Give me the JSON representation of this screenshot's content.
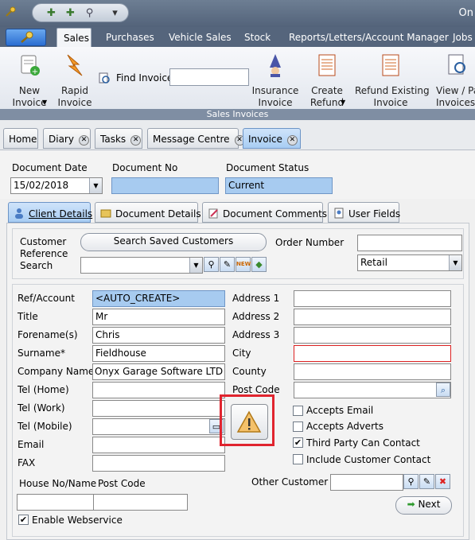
{
  "app": {
    "title_fragment": "On"
  },
  "quick_access": {
    "icons": [
      "add-doc-icon",
      "add-doc-icon",
      "search-doc-icon",
      "dropdown-arrow-icon"
    ]
  },
  "ribbon_tabs": [
    "Sales",
    "Purchases",
    "Vehicle Sales",
    "Stock",
    "Reports/Letters/Account Manager",
    "Jobs"
  ],
  "ribbon": {
    "new_invoice": "New\nInvoice",
    "rapid_invoice": "Rapid\nInvoice",
    "find_invoice": "Find Invoice",
    "find_invoice_value": "",
    "insurance_invoice": "Insurance\nInvoice",
    "create_refund": "Create\nRefund",
    "refund_existing": "Refund Existing\nInvoice",
    "view_pa": "View / Pa\nInvoices",
    "group_label": "Sales Invoices"
  },
  "doc_tabs": [
    {
      "label": "Home",
      "closable": false
    },
    {
      "label": "Diary",
      "closable": true
    },
    {
      "label": "Tasks",
      "closable": true
    },
    {
      "label": "Message Centre",
      "closable": true
    },
    {
      "label": "Invoice",
      "closable": true,
      "active": true
    }
  ],
  "header": {
    "document_date_label": "Document Date",
    "document_date": "15/02/2018",
    "document_no_label": "Document No",
    "document_no": "",
    "document_status_label": "Document Status",
    "document_status": "Current"
  },
  "section_tabs": [
    "Client Details",
    "Document Details",
    "Document Comments",
    "User Fields"
  ],
  "search": {
    "customer_ref_label_1": "Customer",
    "customer_ref_label_2": "Reference",
    "customer_ref_label_3": "Search",
    "saved_customers_button": "Search Saved Customers",
    "order_number_label": "Order Number",
    "order_number": "",
    "price_type": "Retail"
  },
  "client": {
    "ref_label": "Ref/Account",
    "ref": "<AUTO_CREATE>",
    "title_label": "Title",
    "title": "Mr",
    "forename_label": "Forename(s)",
    "forename": "Chris",
    "surname_label": "Surname*",
    "surname": "Fieldhouse",
    "company_label": "Company Name",
    "company": "Onyx Garage Software LTD",
    "tel_home_label": "Tel (Home)",
    "tel_home": "",
    "tel_work_label": "Tel (Work)",
    "tel_work": "",
    "tel_mobile_label": "Tel (Mobile)",
    "tel_mobile": "",
    "email_label": "Email",
    "email": "",
    "fax_label": "FAX",
    "fax": "",
    "house_label": "House No/Name",
    "house": "",
    "postcode_label2": "Post Code",
    "postcode2": "",
    "address1_label": "Address 1",
    "address1": "",
    "address2_label": "Address 2",
    "address2": "",
    "address3_label": "Address 3",
    "address3": "",
    "city_label": "City",
    "city": "",
    "county_label": "County",
    "county": "",
    "postcode_label": "Post Code",
    "postcode": ""
  },
  "options": {
    "accepts_email": {
      "label": "Accepts Email",
      "checked": false
    },
    "accepts_adverts": {
      "label": "Accepts Adverts",
      "checked": false
    },
    "third_party": {
      "label": "Third Party Can Contact",
      "checked": true
    },
    "include_customer": {
      "label": "Include Customer Contact",
      "checked": false
    },
    "enable_webservice": {
      "label": "Enable Webservice",
      "checked": true
    }
  },
  "other_customer_label": "Other Customer",
  "other_customer": "",
  "next_button": "Next",
  "colors": {
    "highlight_frame": "#e0242e",
    "active_tab": "#a8cdf3",
    "input_blue": "#a7cbf0"
  }
}
